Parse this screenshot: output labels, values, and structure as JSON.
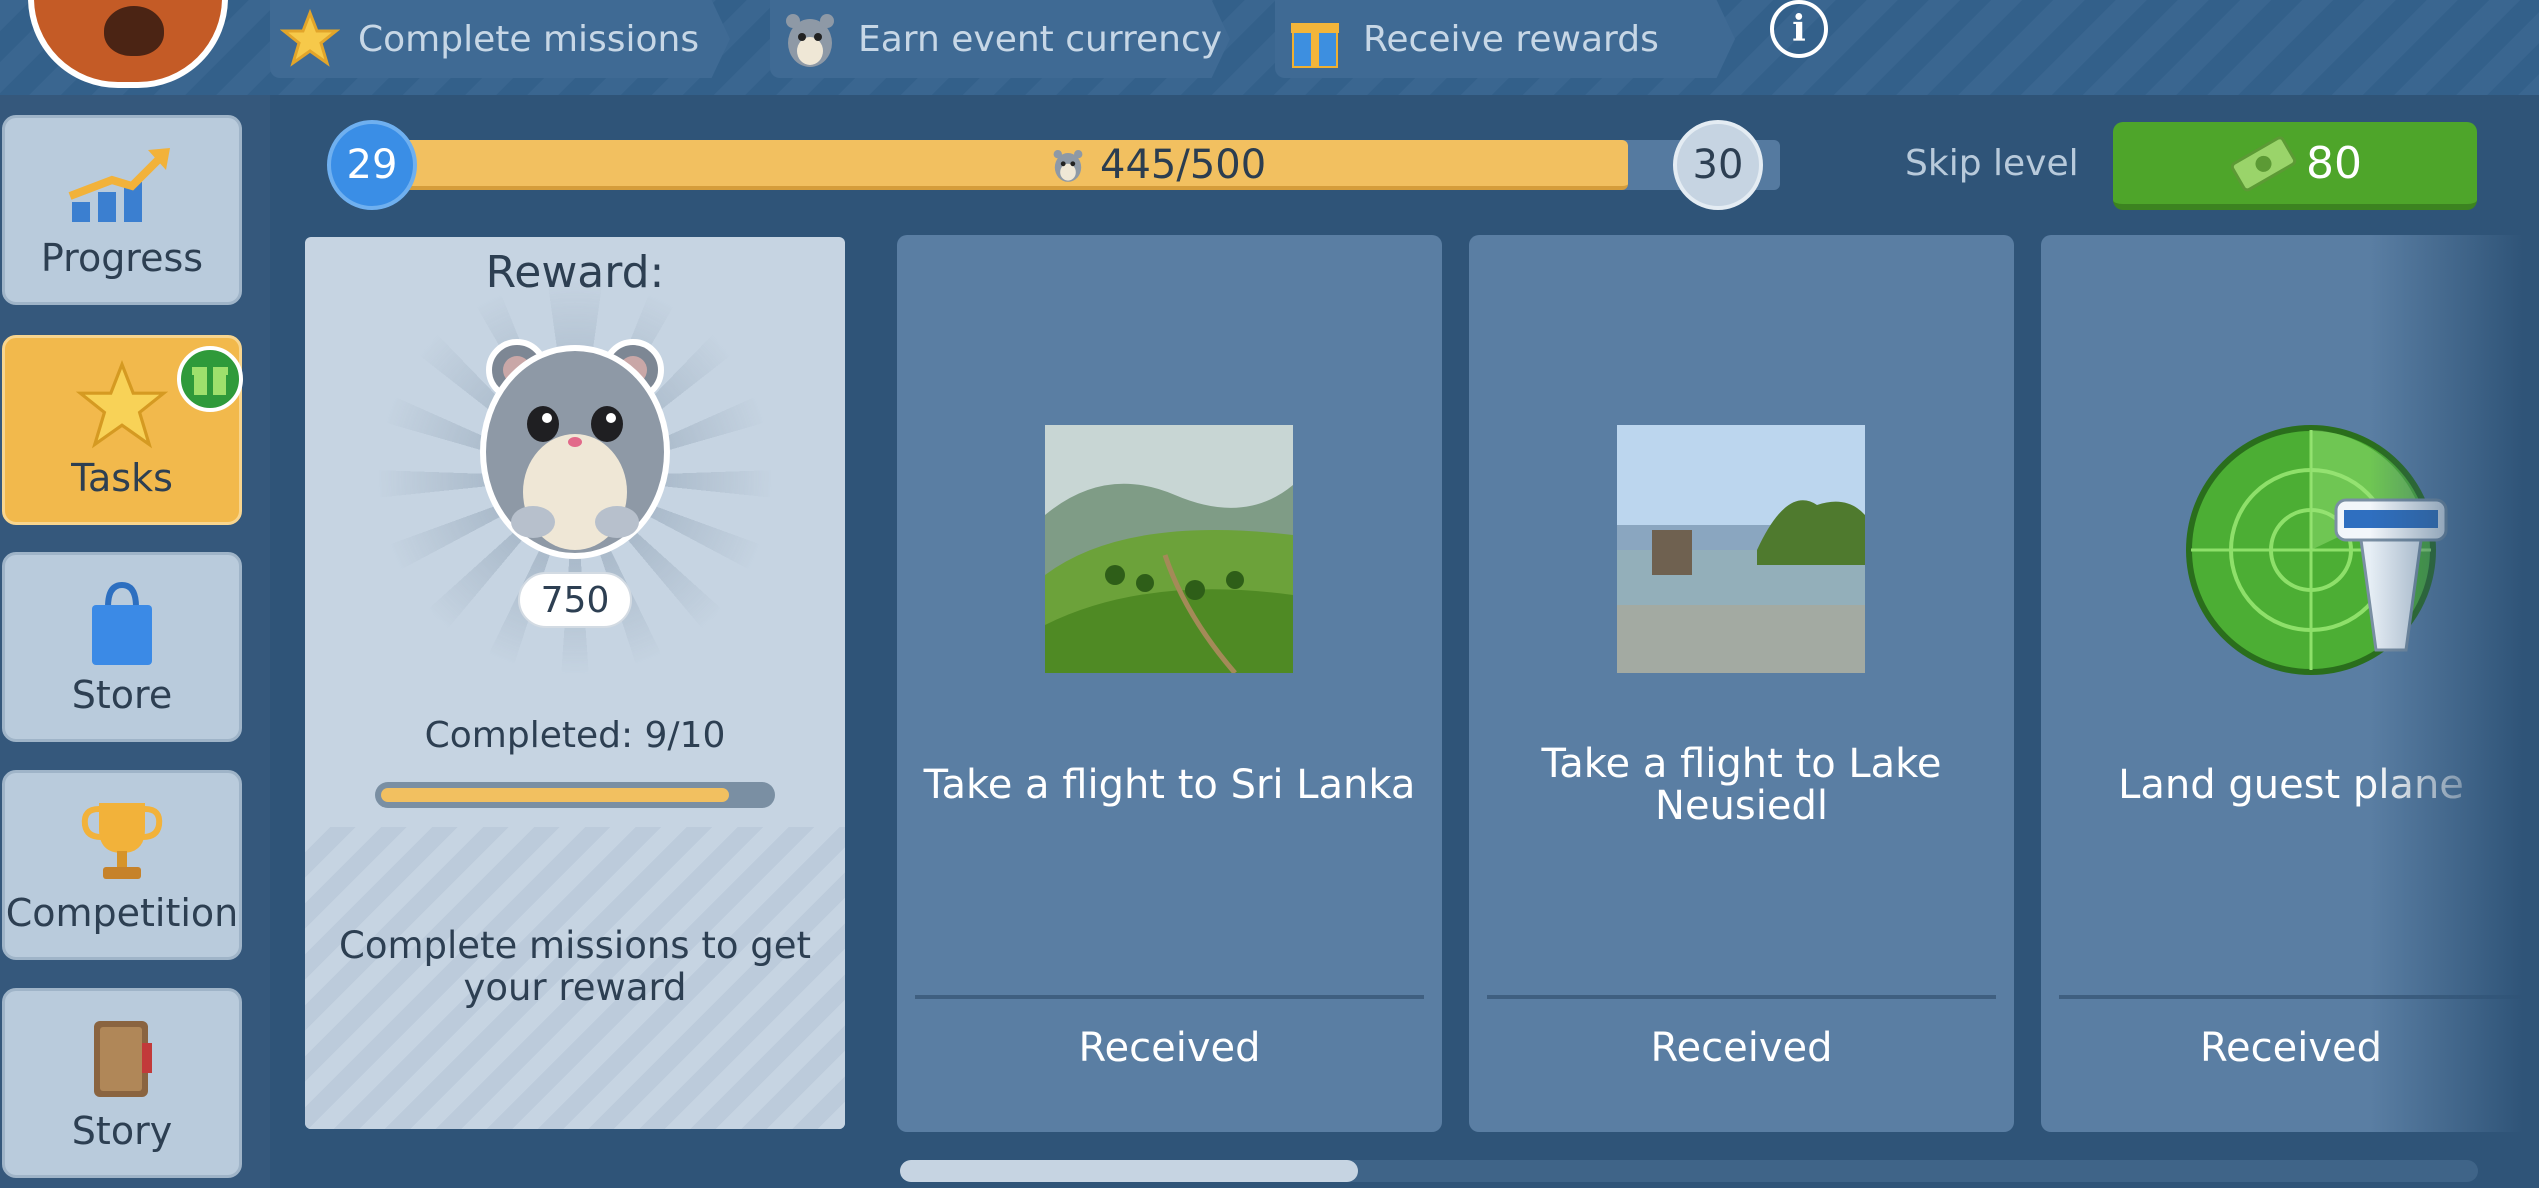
{
  "steps": [
    {
      "label": "Complete missions",
      "icon": "star-icon"
    },
    {
      "label": "Earn event currency",
      "icon": "hamster-icon"
    },
    {
      "label": "Receive rewards",
      "icon": "gift-icon"
    }
  ],
  "info_icon": "info-icon",
  "info_glyph": "i",
  "sidebar": {
    "items": [
      {
        "label": "Progress",
        "icon": "progress-chart-icon"
      },
      {
        "label": "Tasks",
        "icon": "star-icon",
        "active": true,
        "badge_icon": "gift-badge-icon"
      },
      {
        "label": "Store",
        "icon": "shopping-bag-icon"
      },
      {
        "label": "Competition",
        "icon": "trophy-icon"
      },
      {
        "label": "Story",
        "icon": "book-icon"
      }
    ]
  },
  "level": {
    "current": "29",
    "next": "30",
    "progress_text": "445/500",
    "progress_fraction": 0.89,
    "skip_label": "Skip level",
    "skip_cost": "80",
    "skip_icon": "cash-icon"
  },
  "reward": {
    "title": "Reward:",
    "amount": "750",
    "completed": "Completed: 9/10",
    "completed_fraction": 0.9,
    "hint": "Complete missions to get your reward"
  },
  "tasks": [
    {
      "title": "Take a flight to Sri Lanka",
      "status": "Received",
      "image": "tea-plantation-image"
    },
    {
      "title": "Take a flight to Lake Neusiedl",
      "status": "Received",
      "image": "lake-image"
    },
    {
      "title": "Land guest plane",
      "status": "Received",
      "image": "radar-tower-icon"
    }
  ],
  "colors": {
    "accent": "#f2c060",
    "skip_button": "#4ea52a",
    "badge_blue": "#3a8ee6",
    "card": "#5a7ea3"
  }
}
